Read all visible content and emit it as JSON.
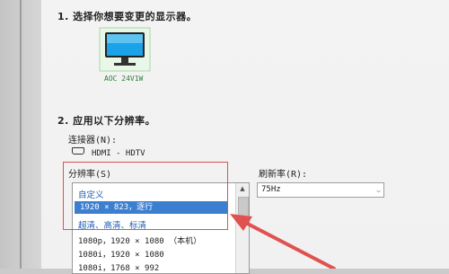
{
  "step1": {
    "heading": "1. 选择你想要变更的显示器。"
  },
  "monitor": {
    "name": "AOC 24V1W"
  },
  "step2": {
    "heading": "2. 应用以下分辨率。"
  },
  "connector": {
    "label": "连接器(N):",
    "value": "HDMI - HDTV"
  },
  "resolution": {
    "label": "分辨率(S)",
    "items": [
      {
        "text": "自定义",
        "type": "group"
      },
      {
        "text": "1920 × 823，逐行",
        "type": "selected"
      },
      {
        "text": "超清、高清、标清",
        "type": "group"
      },
      {
        "text": "1080p，1920 × 1080 （本机）",
        "type": "item"
      },
      {
        "text": "1080i，1920 × 1080",
        "type": "item"
      },
      {
        "text": "1080i，1768 × 992",
        "type": "item"
      }
    ]
  },
  "refresh": {
    "label": "刷新率(R):",
    "value": "75Hz"
  },
  "icons": {
    "scroll_up": "▲",
    "dropdown": "⌵"
  },
  "colors": {
    "selection": "#3c7fd0",
    "annotation": "#e0514f",
    "group_text": "#1f5fb3"
  }
}
